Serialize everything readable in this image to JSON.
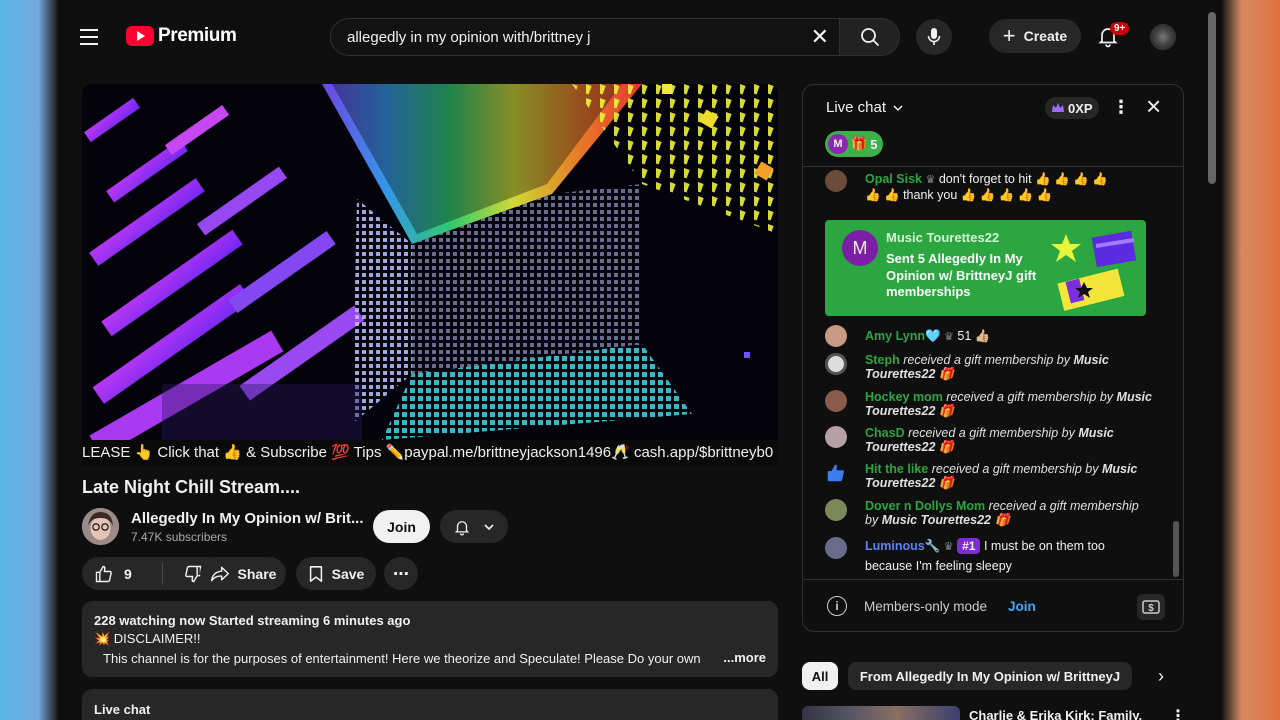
{
  "header": {
    "logo_text": "Premium",
    "search_value": "allegedly in my opinion with/brittney j",
    "create_label": "Create",
    "notif_count": "9+"
  },
  "video": {
    "ticker_text": "LEASE 👆 Click that 👍 & Subscribe 💯 Tips ✏️paypal.me/brittneyjackson1496🥂 cash.app/$brittneyb0"
  },
  "meta": {
    "title": "Late Night Chill Stream....",
    "channel_name": "Allegedly In My Opinion w/ Brit...",
    "subscribers": "7.47K subscribers",
    "join_label": "Join",
    "like_count": "9",
    "share_label": "Share",
    "save_label": "Save"
  },
  "description": {
    "stats": "228 watching now  Started streaming 6 minutes ago",
    "line1": "💥 DISCLAIMER!!",
    "line2": "This channel is for the purposes of entertainment!  Here we theorize and Speculate!  Please Do your own",
    "more": "...more"
  },
  "collapsed_chat_label": "Live chat",
  "chat": {
    "title": "Live chat",
    "xp": "0XP",
    "gift_pill_count": "5",
    "gift_pill_initial": "M",
    "messages": [
      {
        "author": "Opal Sisk",
        "text": "don't forget to hit 👍 👍 👍 👍",
        "text2": "👍 👍 thank you 👍 👍 👍 👍 👍"
      },
      {
        "author": "Amy Lynn🩵",
        "text": "51 👍🏼"
      },
      {
        "author": "Steph",
        "text": "received a gift membership by",
        "bold": "Music Tourettes22 🎁"
      },
      {
        "author": "Hockey mom",
        "text": "received a gift membership by",
        "bold": "Music Tourettes22 🎁"
      },
      {
        "author": "ChasD",
        "text": "received a gift membership by",
        "bold": "Music Tourettes22 🎁"
      },
      {
        "author": "Hit the like",
        "text": "received a gift membership by",
        "bold": "Music Tourettes22 🎁"
      },
      {
        "author": "Dover n Dollys Mom",
        "text": "received a gift membership by",
        "bold": "Music Tourettes22 🎁"
      },
      {
        "author": "Luminous🔧",
        "rank": "#1",
        "text": "I must be on them too",
        "text2": "because I'm feeling sleepy"
      }
    ],
    "gift_card": {
      "initial": "M",
      "name": "Music Tourettes22",
      "text": "Sent 5 Allegedly In My Opinion w/ BrittneyJ gift memberships"
    },
    "footer_mode": "Members-only mode",
    "footer_join": "Join"
  },
  "chips": {
    "all": "All",
    "from": "From Allegedly In My Opinion w/ BrittneyJ"
  },
  "recommendation": {
    "title": "Charlie & Erika Kirk: Family,"
  },
  "colors": {
    "accent_red": "#ff0033",
    "chat_green": "#2ba640",
    "link_blue": "#3ea6ff",
    "member_purple": "#7c1fa6"
  }
}
